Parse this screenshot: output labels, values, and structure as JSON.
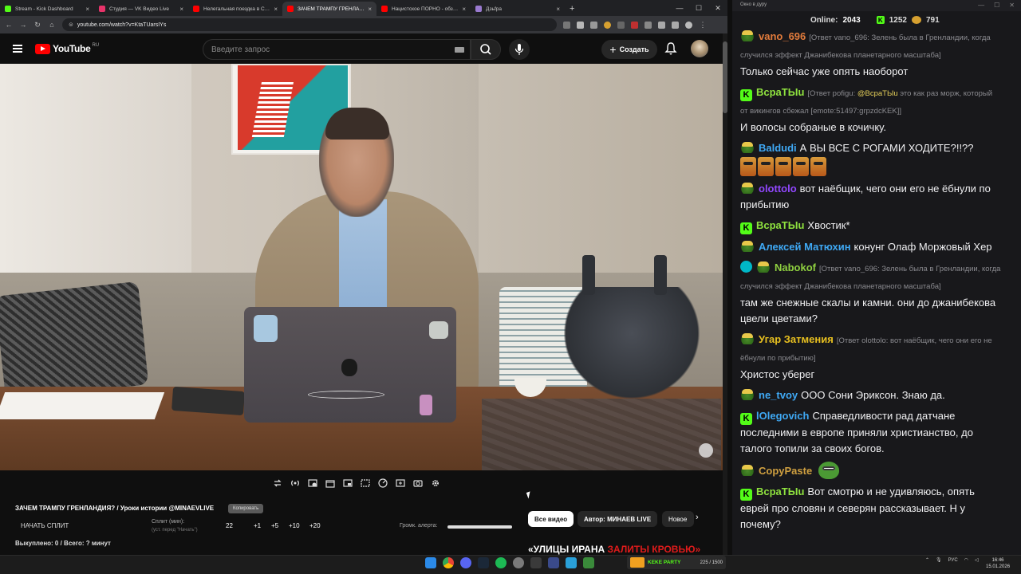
{
  "browser": {
    "tabs": [
      {
        "title": "Stream - Kick Dashboard",
        "color": "#53fc18",
        "active": false
      },
      {
        "title": "Студия — VK Видео Live",
        "color": "#e8336a",
        "active": false
      },
      {
        "title": "Нелегальная поездка в Сири…",
        "color": "#ff0000",
        "active": false
      },
      {
        "title": "ЗАЧЕМ ТРАМПУ ГРЕНЛАН…",
        "color": "#ff0000",
        "active": true
      },
      {
        "title": "Нацистское ПОРНО - обзор в…",
        "color": "#ff0000",
        "active": false
      },
      {
        "title": "Дзьfра",
        "color": "#9a7ad0",
        "active": false
      }
    ],
    "url": "youtube.com/watch?v=KtaTUarsIYs"
  },
  "youtube": {
    "logo": "YouTube",
    "region": "RU",
    "search_placeholder": "Введите запрос",
    "create_label": "Создать"
  },
  "panel": {
    "video_title": "ЗАЧЕМ ТРАМПУ ГРЕНЛАНДИЯ? / Уроки истории @MINAEVLIVE",
    "copy_badge": "Копировать",
    "start_split": "НАЧАТЬ СПЛИТ",
    "split_label": "Сплит (мин):",
    "split_hint": "(уст. перед \"Начать\")",
    "split_value": "22",
    "increments": [
      "+1",
      "+5",
      "+10",
      "+20"
    ],
    "alert_label": "Громк. алерта:",
    "bought": "Выкуплено: 0 / Всего: ? минут",
    "chips": {
      "all": "Все видео",
      "author": "Автор: МИНАЕВ LIVE",
      "new": "Новое"
    },
    "thumb_headline_white": "«УЛИЦЫ ИРАНА",
    "thumb_headline_red": "ЗАЛИТЫ КРОВЬЮ»"
  },
  "chat": {
    "window_title": "Окно в дуру",
    "online_label": "Online:",
    "online_count": "2043",
    "kick_count": "1252",
    "other_count": "791",
    "messages": [
      {
        "badge": "pepe",
        "user": "vano_696",
        "color": "#e37c3c",
        "reply": "[Ответ vano_696: Зелень была в Гренландии, когда случился эффект Джанибекова планетарного масштаба]",
        "text": "Только сейчас уже опять наоборот"
      },
      {
        "badge": "k",
        "user": "ВсраТЫu",
        "color": "#8fe23f",
        "reply_prefix": "[Ответ pofigu:",
        "reply_mention": "@ВсраТЫu",
        "reply_rest": "это как раз морж, который от викингов сбежал [emote:51497:grpzdcKEK]]",
        "text": "И волосы собраные в кочичку."
      },
      {
        "badge": "pepe",
        "user": "Baldudi",
        "color": "#3fa9f5",
        "text": "А ВЫ ВСЕ С РОГАМИ ХОДИТЕ?!!??",
        "emotes": 5
      },
      {
        "badge": "pepe",
        "user": "olottolo",
        "color": "#9147ff",
        "text": "вот наёбщик, чего они его не ёбнули по прибытию"
      },
      {
        "badge": "k",
        "user": "ВсраТЫu",
        "color": "#8fe23f",
        "text": "Хвостик*"
      },
      {
        "badge": "pepe",
        "user": "Алексей Матюхин",
        "color": "#3fa9f5",
        "text": "конунг Олаф Моржовый Хер"
      },
      {
        "badge": "ver",
        "user": "Nabokof",
        "color": "#8fd040",
        "reply": "[Ответ vano_696: Зелень была в Гренландии, когда случился эффект Джанибекова планетарного масштаба]",
        "text": "там же снежные скалы и камни. они до джанибекова цвели цветами?"
      },
      {
        "badge": "pepe",
        "user": "Угар Затмения",
        "color": "#e8c020",
        "reply": "[Ответ olottolo: вот наёбщик, чего они его не ёбнули по прибытию]",
        "text": "Христос уберег"
      },
      {
        "badge": "pepe",
        "user": "ne_tvoy",
        "color": "#3fa9f5",
        "text": "ООО Сони Эриксон. Знаю да."
      },
      {
        "badge": "k",
        "user": "lOlegovich",
        "color": "#3fa9f5",
        "text": "Справедливости рад датчане последними в европе приняли христианство, до талого топили за своих богов."
      },
      {
        "badge": "pepe",
        "user": "CopyPaste",
        "color": "#d0a040",
        "text": "",
        "pepe_emote": true
      },
      {
        "badge": "k",
        "user": "ВсраТЫu",
        "color": "#8fe23f",
        "text": "Вот смотрю и не удивляюсь, опять еврей про словян и северян рассказывает. Н у почему?"
      }
    ]
  },
  "taskbar": {
    "widget_title": "KEKE PARTY",
    "widget_counter": "225 / 1500",
    "lang": "РУС",
    "time": "16:46",
    "date": "15.01.2026"
  }
}
